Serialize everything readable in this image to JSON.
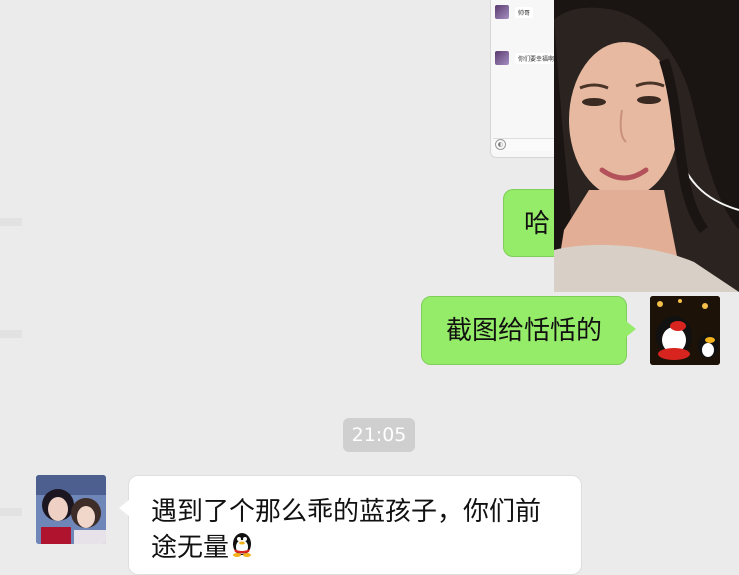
{
  "screenshot_thumbnail": {
    "messages": [
      "帅哥",
      "你们要幸福啊"
    ]
  },
  "messages": [
    {
      "side": "right",
      "type": "text",
      "text": "哈",
      "bubble_color": "#95ec69",
      "partially_covered": true
    },
    {
      "side": "right",
      "type": "text",
      "text": "截图给恬恬的",
      "bubble_color": "#95ec69"
    },
    {
      "type": "timestamp",
      "text": "21:05"
    },
    {
      "side": "left",
      "type": "text",
      "text": "遇到了个那么乖的蓝孩子，你们前途无量",
      "emoji": "qq-penguin",
      "bubble_color": "#ffffff"
    }
  ],
  "colors": {
    "background": "#ebebeb",
    "sent_bubble": "#95ec69",
    "received_bubble": "#ffffff",
    "timestamp_bg": "#cfcfcf"
  }
}
